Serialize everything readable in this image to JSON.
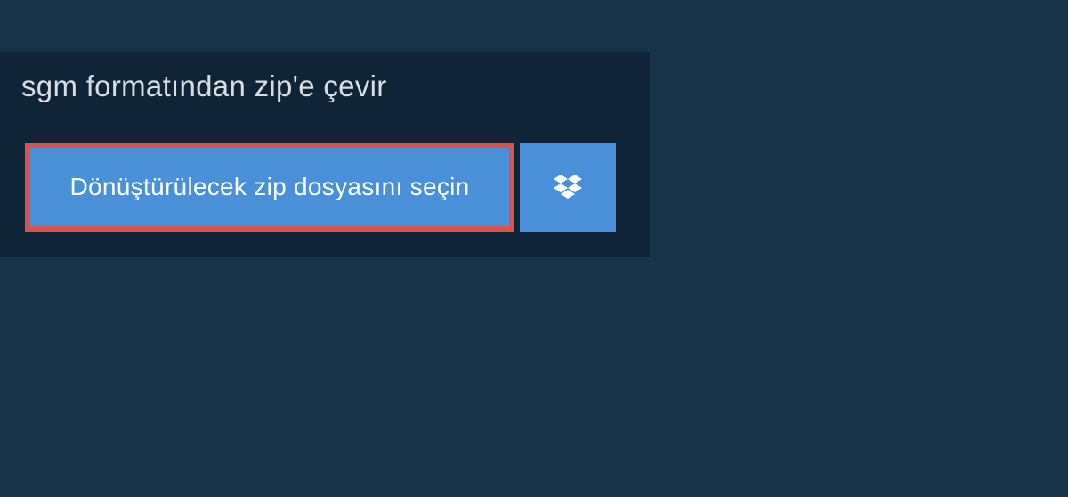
{
  "header": {
    "title": "sgm formatından zip'e çevir"
  },
  "actions": {
    "choose_file_label": "Dönüştürülecek zip dosyasını seçin",
    "dropbox_icon": "dropbox-icon"
  },
  "colors": {
    "page_bg": "#17334a",
    "panel_bg": "#0f2437",
    "button_bg": "#4a90d9",
    "highlight_border": "#d95252",
    "text_light": "#d8dde2",
    "text_white": "#ffffff"
  }
}
